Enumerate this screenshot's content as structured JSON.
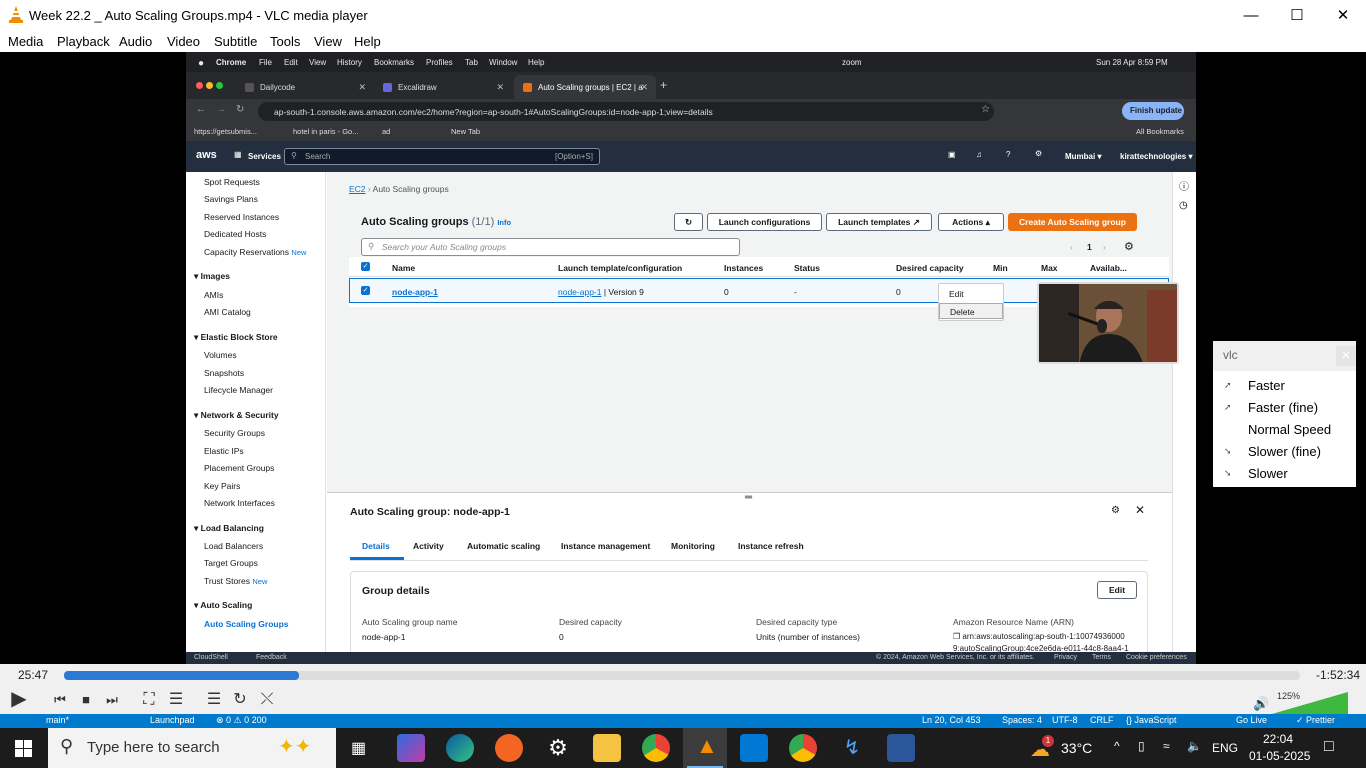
{
  "vlc": {
    "title": "Week 22.2 _ Auto Scaling Groups.mp4 - VLC media player",
    "menu": [
      "Media",
      "Playback",
      "Audio",
      "Video",
      "Subtitle",
      "Tools",
      "View",
      "Help"
    ],
    "elapsed": "25:47",
    "remaining": "-1:52:34",
    "progress_fraction": 0.19,
    "volume_label": "125%",
    "volume_fraction": 1.0,
    "speed_popup": {
      "title": "vlc",
      "items": [
        "Faster",
        "Faster (fine)",
        "Normal Speed",
        "Slower (fine)",
        "Slower"
      ]
    }
  },
  "mac": {
    "app": "Chrome",
    "menus": [
      "File",
      "Edit",
      "View",
      "History",
      "Bookmarks",
      "Profiles",
      "Tab",
      "Window",
      "Help"
    ],
    "zoom": "zoom",
    "datetime": "Sun 28 Apr  8:59 PM"
  },
  "chrome": {
    "tabs": [
      {
        "label": "Dailycode",
        "active": false
      },
      {
        "label": "Excalidraw",
        "active": false
      },
      {
        "label": "Auto Scaling groups | EC2 | a",
        "active": true
      }
    ],
    "url": "ap-south-1.console.aws.amazon.com/ec2/home?region=ap-south-1#AutoScalingGroups:id=node-app-1;view=details",
    "finish_update": "Finish update",
    "bookmarks": [
      "https://getsubmis...",
      "hotel in paris - Go...",
      "ad",
      "New Tab"
    ],
    "all_bookmarks": "All Bookmarks"
  },
  "aws": {
    "logo": "aws",
    "services": "Services",
    "search_placeholder": "Search",
    "search_shortcut": "[Option+S]",
    "region": "Mumbai ▾",
    "account": "kirattechnologies ▾",
    "sidebar": {
      "items_top": [
        "Spot Requests",
        "Savings Plans",
        "Reserved Instances",
        "Dedicated Hosts",
        "Capacity Reservations"
      ],
      "new_label": "New",
      "images_header": "Images",
      "images_items": [
        "AMIs",
        "AMI Catalog"
      ],
      "ebs_header": "Elastic Block Store",
      "ebs_items": [
        "Volumes",
        "Snapshots",
        "Lifecycle Manager"
      ],
      "network_header": "Network & Security",
      "network_items": [
        "Security Groups",
        "Elastic IPs",
        "Placement Groups",
        "Key Pairs",
        "Network Interfaces"
      ],
      "lb_header": "Load Balancing",
      "lb_items": [
        "Load Balancers",
        "Target Groups",
        "Trust Stores"
      ],
      "as_header": "Auto Scaling",
      "as_items": [
        "Auto Scaling Groups"
      ]
    },
    "breadcrumb": [
      "EC2",
      "Auto Scaling groups"
    ],
    "heading": "Auto Scaling groups",
    "count": "(1/1)",
    "info": "Info",
    "buttons": {
      "launch_configurations": "Launch configurations",
      "launch_templates": "Launch templates",
      "actions": "Actions",
      "create": "Create Auto Scaling group"
    },
    "actions_menu": [
      "Edit",
      "Delete"
    ],
    "table_search_placeholder": "Search your Auto Scaling groups",
    "page": "1",
    "columns": [
      "Name",
      "Launch template/configuration",
      "Instances",
      "Status",
      "Desired capacity",
      "Min",
      "Max",
      "Availab..."
    ],
    "row": {
      "name": "node-app-1",
      "template": "node-app-1",
      "version": "| Version 9",
      "instances": "0",
      "status": "-",
      "desired": "0",
      "min": "0"
    },
    "detail": {
      "title": "Auto Scaling group: node-app-1",
      "tabs": [
        "Details",
        "Activity",
        "Automatic scaling",
        "Instance management",
        "Monitoring",
        "Instance refresh"
      ],
      "section": "Group details",
      "edit": "Edit",
      "fields": [
        {
          "label": "Auto Scaling group name",
          "value": "node-app-1"
        },
        {
          "label": "Desired capacity",
          "value": "0"
        },
        {
          "label": "Desired capacity type",
          "value": "Units (number of instances)"
        },
        {
          "label": "Amazon Resource Name (ARN)",
          "value": "arn:aws:autoscaling:ap-south-1:10074936000"
        }
      ],
      "arn_line2": "9:autoScalingGroup:4ce2e6da-e011-44c8-8aa4-1"
    },
    "footer": {
      "cloudshell": "CloudShell",
      "feedback": "Feedback",
      "copyright": "© 2024, Amazon Web Services, Inc. or its affiliates.",
      "privacy": "Privacy",
      "terms": "Terms",
      "cookies": "Cookie preferences"
    }
  },
  "vscode_status": {
    "branch": "main*",
    "launchpad": "Launchpad",
    "problems": "⊗ 0 ⚠ 0  200",
    "position": "Ln 20, Col 453",
    "spaces": "Spaces: 4",
    "encoding": "UTF-8",
    "eol": "CRLF",
    "language": "{} JavaScript",
    "golive": "Go Live",
    "prettier": "✓ Prettier"
  },
  "taskbar": {
    "search_placeholder": "Type here to search",
    "weather": "33°C",
    "weather_badge": "1",
    "language": "ENG",
    "time": "22:04",
    "date": "01-05-2025"
  }
}
